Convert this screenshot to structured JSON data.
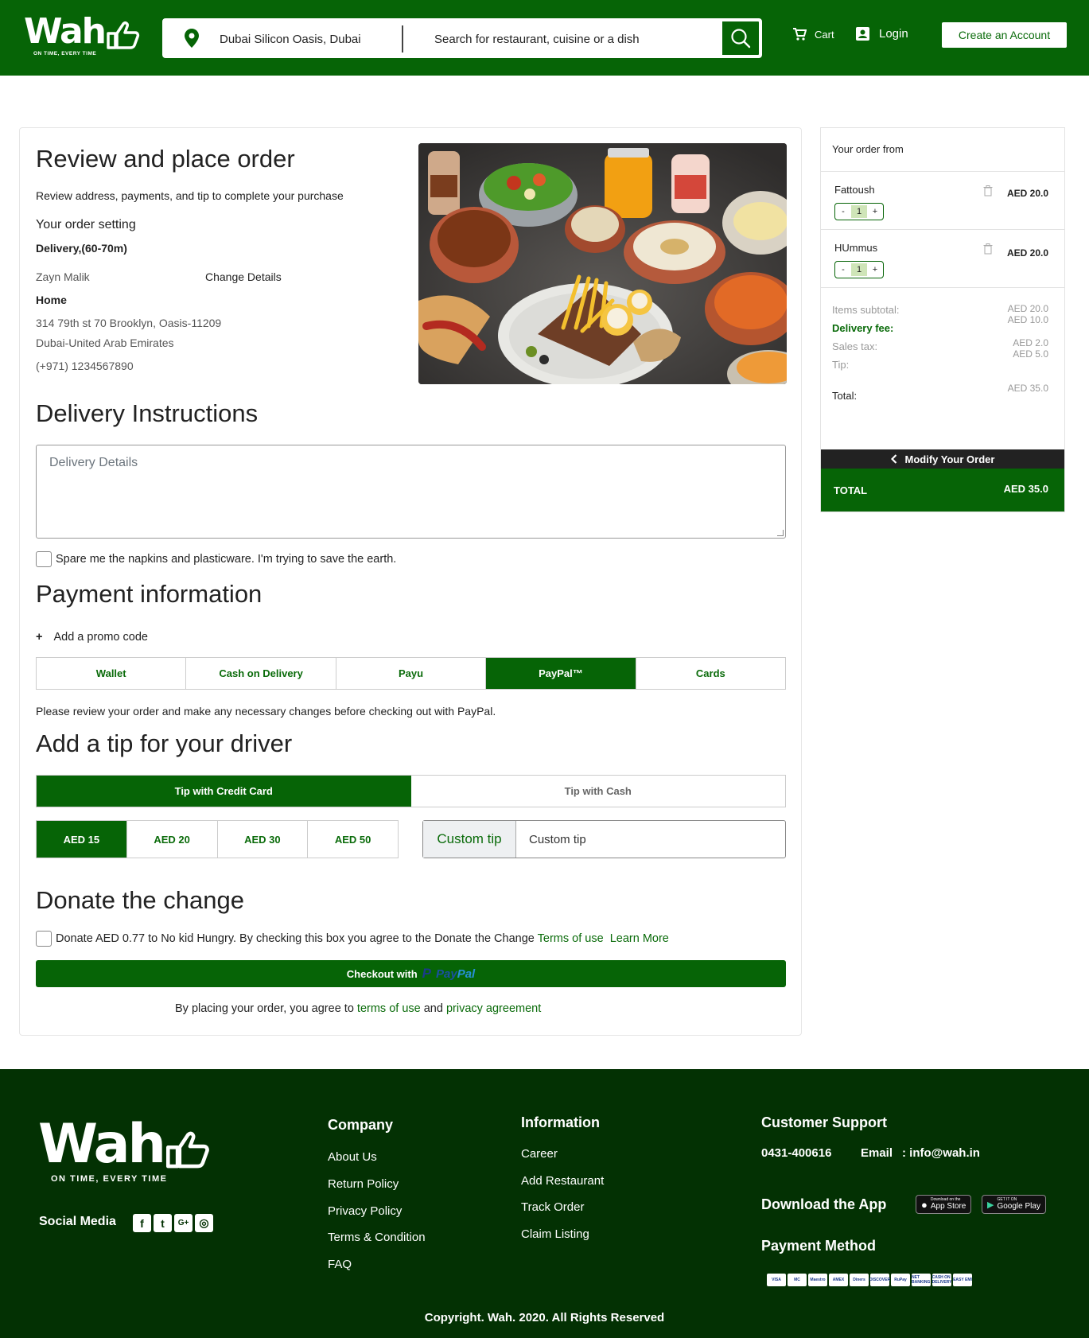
{
  "header": {
    "logo_text": "Wah",
    "logo_tagline": "ON TIME, EVERY TIME",
    "location": "Dubai Silicon Oasis, Dubai",
    "search_placeholder": "Search for restaurant, cuisine or a dish",
    "cart_label": "Cart",
    "login_label": "Login",
    "create_account_label": "Create an Account"
  },
  "review": {
    "title": "Review and place order",
    "subtitle": "Review address, payments, and tip to complete your purchase",
    "order_setting_label": "Your order setting",
    "delivery_mode": "Delivery,(60-70m)",
    "customer_name": "Zayn Malik",
    "change_details": "Change Details",
    "address_label": "Home",
    "address_line1": "314 79th st 70 Brooklyn, Oasis-11209",
    "address_line2": "Dubai-United Arab Emirates",
    "phone": "(+971) 1234567890"
  },
  "instructions": {
    "title": "Delivery Instructions",
    "placeholder": "Delivery Details",
    "napkins_label": "Spare me the napkins and plasticware. I'm trying to save the earth."
  },
  "payment": {
    "title": "Payment information",
    "promo_label": "Add a promo code",
    "tabs": [
      {
        "label": "Wallet"
      },
      {
        "label": "Cash on Delivery"
      },
      {
        "label": "Payu"
      },
      {
        "label": "PayPal™"
      },
      {
        "label": "Cards"
      }
    ],
    "active_tab": "PayPal™",
    "paypal_note": "Please review your order and make any necessary changes before checking out with PayPal."
  },
  "tip": {
    "title": "Add a tip for your driver",
    "mode_credit": "Tip with Credit Card",
    "mode_cash": "Tip with Cash",
    "amounts": [
      "AED 15",
      "AED 20",
      "AED 30",
      "AED 50"
    ],
    "selected_amount": "AED 15",
    "custom_label": "Custom tip",
    "custom_value": "Custom tip"
  },
  "donate": {
    "title": "Donate the change",
    "text": "Donate AED 0.77 to No kid Hungry. By checking this box you agree to the Donate the Change",
    "terms_link": "Terms of use",
    "learn_more": "Learn More"
  },
  "checkout": {
    "label": "Checkout with",
    "paypal_mark": "P",
    "paypal_word_a": "Pay",
    "paypal_word_b": "Pal",
    "agree_prefix": "By placing your order, you agree to",
    "terms_link": "terms of use",
    "and": "and",
    "privacy_link": "privacy agreement"
  },
  "sidebar": {
    "title": "Your order from",
    "items": [
      {
        "name": "Fattoush",
        "qty": "1",
        "price": "AED 20.0"
      },
      {
        "name": "HUmmus",
        "qty": "1",
        "price": "AED 20.0"
      }
    ],
    "summary": {
      "subtotal_label": "Items subtotal:",
      "delivery_label": "Delivery fee:",
      "tax_label": "Sales tax:",
      "tip_label": "Tip:",
      "total_label": "Total:",
      "subtotal": "AED 20.0",
      "delivery": "AED 10.0",
      "tax": "AED 2.0",
      "tip": "AED 5.0",
      "total": "AED 35.0"
    },
    "modify_label": "Modify Your Order",
    "total_bar_label": "TOTAL",
    "total_bar_value": "AED 35.0"
  },
  "footer": {
    "logo_text": "Wah",
    "logo_tagline": "ON TIME, EVERY TIME",
    "social_label": "Social Media",
    "company_title": "Company",
    "company_links": [
      "About Us",
      "Return Policy",
      "Privacy Policy",
      "Terms & Condition",
      "FAQ"
    ],
    "info_title": "Information",
    "info_links": [
      "Career",
      "Add Restaurant",
      "Track Order",
      "Claim Listing"
    ],
    "support_title": "Customer Support",
    "phone": "0431-400616",
    "email_label": "Email",
    "email": ": info@wah.in",
    "app_title": "Download the App",
    "app_store_small": "Download on the",
    "app_store": "App Store",
    "play_small": "GET IT ON",
    "play": "Google Play",
    "payment_title": "Payment Method",
    "payment_icons": [
      "VISA",
      "MC",
      "Maestro",
      "AMEX",
      "Diners",
      "DISCOVER",
      "RuPay",
      "NET BANKING",
      "CASH ON DELIVERY",
      "EASY EMI"
    ],
    "copyright": "Copyright. Wah. 2020. All Rights Reserved"
  },
  "colors": {
    "brand_green": "#066406",
    "footer_green": "#033103",
    "link_green": "#0a6b0a"
  }
}
